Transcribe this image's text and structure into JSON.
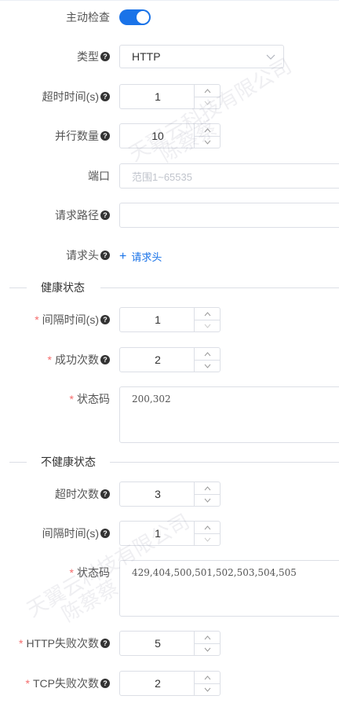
{
  "health_check": {
    "active_check": {
      "label": "主动检查",
      "enabled": true
    },
    "type": {
      "label": "类型",
      "value": "HTTP"
    },
    "timeout": {
      "label": "超时时间(s)",
      "value": "1"
    },
    "parallel": {
      "label": "并行数量",
      "value": "10"
    },
    "port": {
      "label": "端口",
      "placeholder": "范围1~65535"
    },
    "request_path": {
      "label": "请求路径",
      "value": ""
    },
    "request_headers": {
      "label": "请求头",
      "add_label": "请求头"
    }
  },
  "healthy_section": {
    "title": "健康状态",
    "interval": {
      "label": "间隔时间(s)",
      "value": "1"
    },
    "success_count": {
      "label": "成功次数",
      "value": "2"
    },
    "status_codes": {
      "label": "状态码",
      "value": "200,302"
    }
  },
  "unhealthy_section": {
    "title": "不健康状态",
    "timeout_count": {
      "label": "超时次数",
      "value": "3"
    },
    "interval": {
      "label": "间隔时间(s)",
      "value": "1"
    },
    "status_codes": {
      "label": "状态码",
      "value": "429,404,500,501,502,503,504,505"
    },
    "http_failures": {
      "label": "HTTP失败次数",
      "value": "5"
    },
    "tcp_failures": {
      "label": "TCP失败次数",
      "value": "2"
    }
  },
  "watermark": {
    "text_company": "天翼云科技有限公司",
    "text_name": "陈蔡蔡"
  },
  "colors": {
    "accent": "#1a73e8",
    "required": "#f56c6c",
    "border": "#dcdfe6"
  }
}
